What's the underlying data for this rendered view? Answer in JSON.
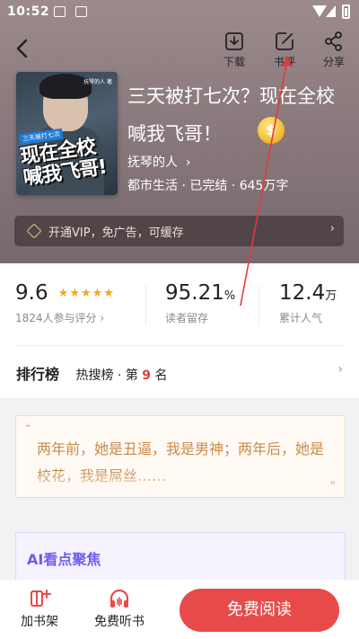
{
  "status_bar": {
    "time": "10:52",
    "icons": [
      "gallery-icon",
      "a-icon",
      "wifi-icon",
      "signal-icon",
      "battery-icon"
    ]
  },
  "header": {
    "back_icon": "back-arrow-icon",
    "actions": [
      {
        "label": "下载",
        "icon": "download-icon"
      },
      {
        "label": "书评",
        "icon": "edit-icon"
      },
      {
        "label": "分享",
        "icon": "share-icon"
      }
    ]
  },
  "book": {
    "cover_tag": "三天被打七次",
    "cover_title": "现在全校 喊我飞哥!",
    "cover_author": "抚琴的人 著",
    "title": "三天被打七次？现在全校喊我飞哥！",
    "author": "抚琴的人",
    "meta": "都市生活 · 已完结 · 645万字"
  },
  "vip_banner": {
    "text": "开通VIP，免广告，可缓存"
  },
  "stats": {
    "rating": {
      "value": "9.6",
      "sub": "1824人参与评分",
      "stars": 5
    },
    "retention": {
      "value": "95.21",
      "unit": "%",
      "sub": "读者留存"
    },
    "popularity": {
      "value": "12.4",
      "unit": "万",
      "sub": "累计人气"
    }
  },
  "rank": {
    "heading": "排行榜",
    "list": "热搜榜",
    "prefix": "第",
    "number": "9",
    "suffix": "名"
  },
  "quote": {
    "text": "两年前，她是丑逼，我是男神；两年后，她是校花，我是屌丝……"
  },
  "ai_section": {
    "title": "AI看点聚焦"
  },
  "bottom_bar": {
    "add_shelf": "加书架",
    "listen": "免费听书",
    "read": "免费阅读"
  },
  "colors": {
    "accent_red": "#e84a4a",
    "quote_text": "#c98b4b",
    "ai_purple": "#6d5cf2",
    "annotation_arrow": "#e23b3b"
  }
}
